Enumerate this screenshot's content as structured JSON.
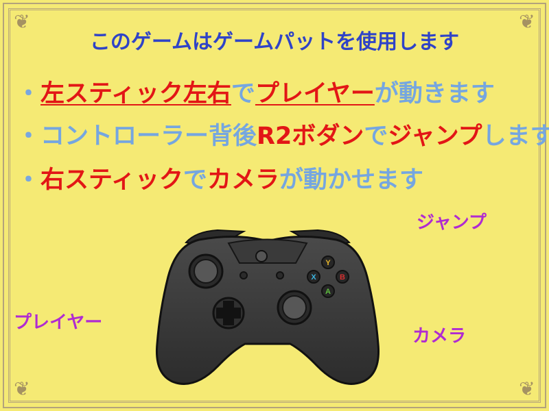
{
  "title": "このゲームはゲームパットを使用します",
  "instructions": [
    {
      "bullet": "・",
      "segments": [
        {
          "text": "左スティック左右",
          "style": "red-underline"
        },
        {
          "text": "で",
          "style": "blue"
        },
        {
          "text": "プレイヤー",
          "style": "red-underline"
        },
        {
          "text": "が動きます",
          "style": "blue"
        }
      ]
    },
    {
      "bullet": "・",
      "segments": [
        {
          "text": "コントローラー背後",
          "style": "blue"
        },
        {
          "text": "R2ボダン",
          "style": "red"
        },
        {
          "text": "で",
          "style": "blue"
        },
        {
          "text": "ジャンプ",
          "style": "red"
        },
        {
          "text": "します",
          "style": "blue"
        }
      ]
    },
    {
      "bullet": "・",
      "segments": [
        {
          "text": "右スティック",
          "style": "red"
        },
        {
          "text": "で",
          "style": "blue"
        },
        {
          "text": "カメラ",
          "style": "red"
        },
        {
          "text": "が動かせます",
          "style": "blue"
        }
      ]
    }
  ],
  "labels": {
    "jump": "ジャンプ",
    "player": "プレイヤー",
    "camera": "カメラ"
  },
  "controller": {
    "buttons": {
      "y": "Y",
      "b": "B",
      "a": "A",
      "x": "X"
    }
  },
  "colors": {
    "background": "#f5ea74",
    "title_blue": "#2f43c7",
    "text_blue": "#75a6e0",
    "text_red": "#e21616",
    "label_magenta": "#b02bd1",
    "border": "#b3a37c"
  }
}
